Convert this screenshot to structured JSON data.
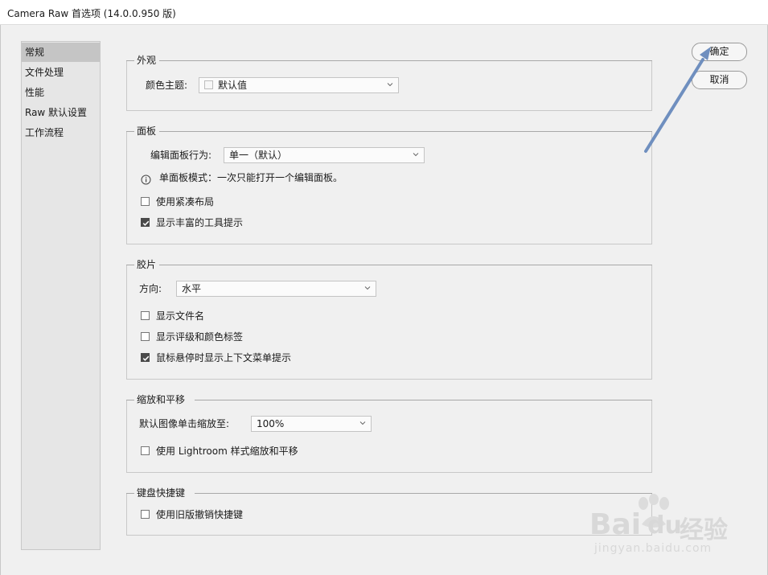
{
  "window": {
    "title": "Camera Raw 首选项 (14.0.0.950 版)"
  },
  "sidebar": {
    "items": [
      {
        "label": "常规",
        "active": true
      },
      {
        "label": "文件处理",
        "active": false
      },
      {
        "label": "性能",
        "active": false
      },
      {
        "label": "Raw 默认设置",
        "active": false
      },
      {
        "label": "工作流程",
        "active": false
      }
    ]
  },
  "appearance": {
    "legend": "外观",
    "theme_label": "颜色主题:",
    "theme_value": "默认值"
  },
  "panels": {
    "legend": "面板",
    "behavior_label": "编辑面板行为:",
    "behavior_value": "单一（默认）",
    "info_text": "单面板模式：一次只能打开一个编辑面板。",
    "compact_label": "使用紧凑布局",
    "compact_checked": false,
    "tooltips_label": "显示丰富的工具提示",
    "tooltips_checked": true
  },
  "filmstrip": {
    "legend": "胶片",
    "orientation_label": "方向:",
    "orientation_value": "水平",
    "show_filename_label": "显示文件名",
    "show_filename_checked": false,
    "show_ratings_label": "显示评级和颜色标签",
    "show_ratings_checked": false,
    "hover_hint_label": "鼠标悬停时显示上下文菜单提示",
    "hover_hint_checked": true
  },
  "zoom": {
    "legend": "缩放和平移",
    "click_zoom_label": "默认图像单击缩放至:",
    "click_zoom_value": "100%",
    "lightroom_label": "使用 Lightroom 样式缩放和平移",
    "lightroom_checked": false
  },
  "shortcuts": {
    "legend": "键盘快捷键",
    "legacy_label": "使用旧版撤销快捷键",
    "legacy_checked": false
  },
  "buttons": {
    "ok_label": "确定",
    "cancel_label": "取消"
  },
  "annotation": {
    "arrow_color": "#6f8fbf"
  },
  "watermark": {
    "brand_a": "Bai",
    "brand_b": "du",
    "brand_c": "经验",
    "url": "jingyan.baidu.com"
  }
}
